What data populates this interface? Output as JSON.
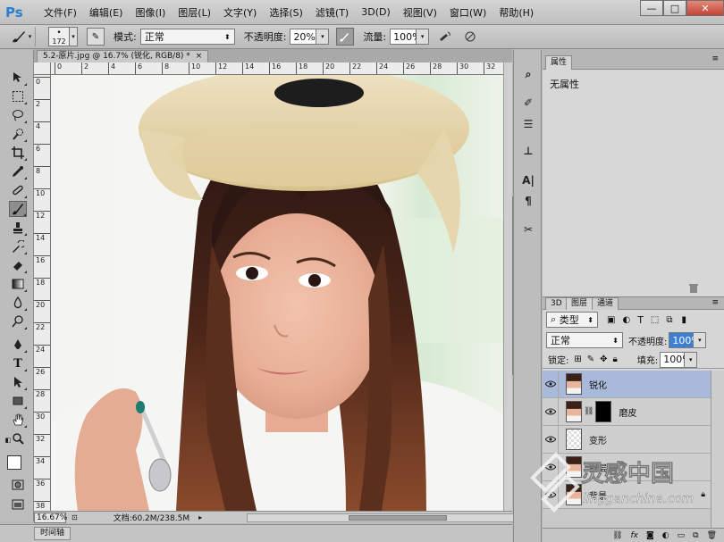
{
  "app": {
    "logo": "Ps"
  },
  "menu": [
    "文件(F)",
    "编辑(E)",
    "图像(I)",
    "图层(L)",
    "文字(Y)",
    "选择(S)",
    "滤镜(T)",
    "3D(D)",
    "视图(V)",
    "窗口(W)",
    "帮助(H)"
  ],
  "window_controls": {
    "minimize": "—",
    "maximize": "□",
    "close": "✕"
  },
  "options": {
    "brush_size": "172",
    "mode_label": "模式:",
    "mode_value": "正常",
    "opacity_label": "不透明度:",
    "opacity_value": "20%",
    "flow_label": "流量:",
    "flow_value": "100%"
  },
  "document": {
    "tab_title": "5.2-原片.jpg @ 16.7% (锐化, RGB/8) *",
    "close": "×",
    "zoom": "16.67%",
    "doc_info": "文档:60.2M/238.5M",
    "ruler_h": [
      "0",
      "2",
      "4",
      "6",
      "8",
      "10",
      "12",
      "14",
      "16",
      "18",
      "20",
      "22",
      "24",
      "26",
      "28",
      "30",
      "32"
    ],
    "ruler_v": [
      "0",
      "2",
      "4",
      "6",
      "8",
      "10",
      "12",
      "14",
      "16",
      "18",
      "20",
      "22",
      "24",
      "26",
      "28",
      "30",
      "32",
      "34",
      "36",
      "38"
    ]
  },
  "timeline_tab": "时间轴",
  "properties": {
    "tab": "属性",
    "content": "无属性"
  },
  "layers_panel": {
    "tabs": [
      "3D",
      "图层",
      "通道"
    ],
    "filter_kind": "类型",
    "blend_mode": "正常",
    "opacity_label": "不透明度:",
    "opacity_value": "100%",
    "lock_label": "锁定:",
    "fill_label": "填充:",
    "fill_value": "100%",
    "layers": [
      {
        "name": "锐化",
        "active": true,
        "mask": false
      },
      {
        "name": "磨皮",
        "active": false,
        "mask": true
      },
      {
        "name": "变形",
        "active": false,
        "mask": false
      },
      {
        "name": "图层",
        "active": false,
        "mask": false
      },
      {
        "name": "背景",
        "active": false,
        "mask": false
      }
    ],
    "footer_icons": [
      "link-icon",
      "fx-icon",
      "mask-icon",
      "adjustment-icon",
      "group-icon",
      "new-layer-icon",
      "delete-icon"
    ]
  },
  "watermark": {
    "title": "灵感中国",
    "url": "lingganchina.com"
  }
}
